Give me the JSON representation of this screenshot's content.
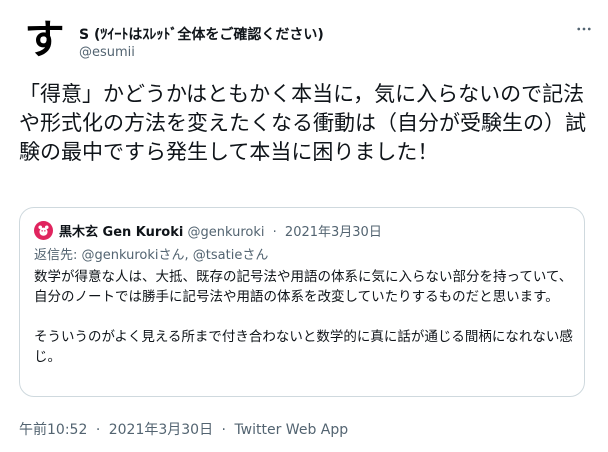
{
  "author": {
    "avatar_char": "す",
    "name": "S (ﾂｲｰﾄはｽﾚｯﾄﾞ全体をご確認ください)",
    "handle": "@esumii"
  },
  "tweet": {
    "text": "「得意」かどうかはともかく本当に，気に入らないので記法や形式化の方法を変えたくなる衝動は（自分が受験生の）試験の最中ですら発生して本当に困りました！"
  },
  "quote": {
    "name": "黒木玄 Gen Kuroki",
    "handle": "@genkuroki",
    "dot": "·",
    "date": "2021年3月30日",
    "reply_prefix": "返信先: ",
    "reply_to_1": "@genkurokiさん",
    "reply_joiner": ", ",
    "reply_to_2": "@tsatieさん",
    "paragraph_1": "数学が得意な人は、大抵、既存の記号法や用語の体系に気に入らない部分を持っていて、自分のノートでは勝手に記号法や用語の体系を改変していたりするものだと思います。",
    "paragraph_2": "そういうのがよく見える所まで付き合わないと数学的に真に話が通じる間柄になれない感じ。"
  },
  "footer": {
    "time": "午前10:52",
    "dot": "·",
    "date": "2021年3月30日",
    "source": "Twitter Web App"
  },
  "colors": {
    "text": "#0f1419",
    "secondary": "#536471",
    "border": "#cfd9de",
    "quote_avatar": "#e0245e"
  },
  "icons": {
    "more": "more-horizontal-icon"
  }
}
